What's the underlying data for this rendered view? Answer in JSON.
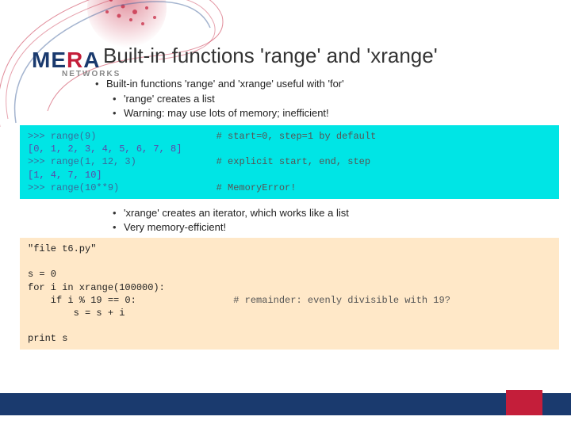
{
  "logo": {
    "text": "MERA",
    "subtitle": "NETWORKS"
  },
  "title": "Built-in functions 'range' and 'xrange'",
  "bullets_top": {
    "main": "Built-in functions 'range' and 'xrange' useful with 'for'",
    "sub1": "'range' creates a list",
    "sub2": "Warning: may use lots of memory; inefficient!"
  },
  "code1": {
    "l1a": ">>> range(9)",
    "l1b": "# start=0, step=1 by default",
    "l2": "[0, 1, 2, 3, 4, 5, 6, 7, 8]",
    "l3a": ">>> range(1, 12, 3)",
    "l3b": "# explicit start, end, step",
    "l4": "[1, 4, 7, 10]",
    "l5a": ">>> range(10**9)",
    "l5b": "# MemoryError!"
  },
  "bullets_mid": {
    "sub1": "'xrange' creates an iterator, which works like a list",
    "sub2": "Very memory-efficient!"
  },
  "code2": {
    "l1": "\"file t6.py\"",
    "l2": "",
    "l3": "s = 0",
    "l4": "for i in xrange(100000):",
    "l5a": "    if i % 19 == 0:",
    "l5b": "# remainder: evenly divisible with 19?",
    "l6": "        s = s + i",
    "l7": "",
    "l8": "print s"
  }
}
